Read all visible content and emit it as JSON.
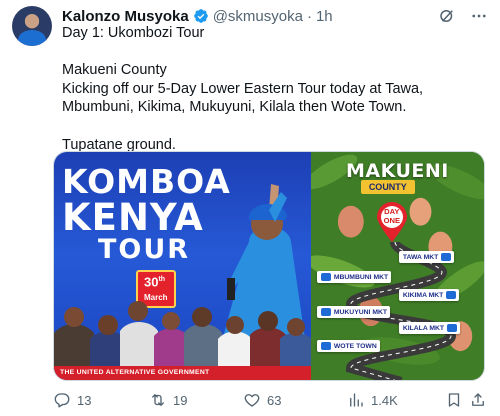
{
  "post": {
    "author_name": "Kalonzo Musyoka",
    "handle": "@skmusyoka",
    "separator": "·",
    "time": "1h",
    "text": "Day 1: Ukombozi Tour\n\nMakueni County\nKicking off our 5-Day Lower Eastern Tour today at Tawa, Mbumbuni, Kikima, Mukuyuni, Kilala then Wote Town.\n\nTupatane ground."
  },
  "media": {
    "left": {
      "line1": "KOMBOA",
      "line2": "KENYA",
      "line3": "TOUR",
      "date_num": "30",
      "date_sup": "th",
      "date_month": "March",
      "footer": "THE UNITED ALTERNATIVE GOVERNMENT"
    },
    "right": {
      "title": "MAKUENI",
      "subtitle": "COUNTY",
      "pin_line1": "DAY",
      "pin_line2": "ONE",
      "stops": [
        "TAWA MKT",
        "MBUMBUNI MKT",
        "KIKIMA MKT",
        "MUKUYUNI MKT",
        "KILALA MKT",
        "WOTE TOWN"
      ]
    }
  },
  "engagement": {
    "replies": "13",
    "reposts": "19",
    "likes": "63",
    "views": "1.4K"
  },
  "icons": {
    "verified": "verified-badge-icon",
    "grok": "grok-icon",
    "more": "more-icon",
    "reply": "reply-icon",
    "repost": "repost-icon",
    "like": "heart-icon",
    "views": "views-icon",
    "bookmark": "bookmark-icon",
    "share": "share-icon"
  },
  "colors": {
    "accent": "#1d9bf0",
    "muted": "#536471",
    "poster_blue": "#2659d6",
    "poster_red": "#e3222c",
    "poster_yellow": "#f3c230",
    "foliage": "#2f6b22"
  }
}
